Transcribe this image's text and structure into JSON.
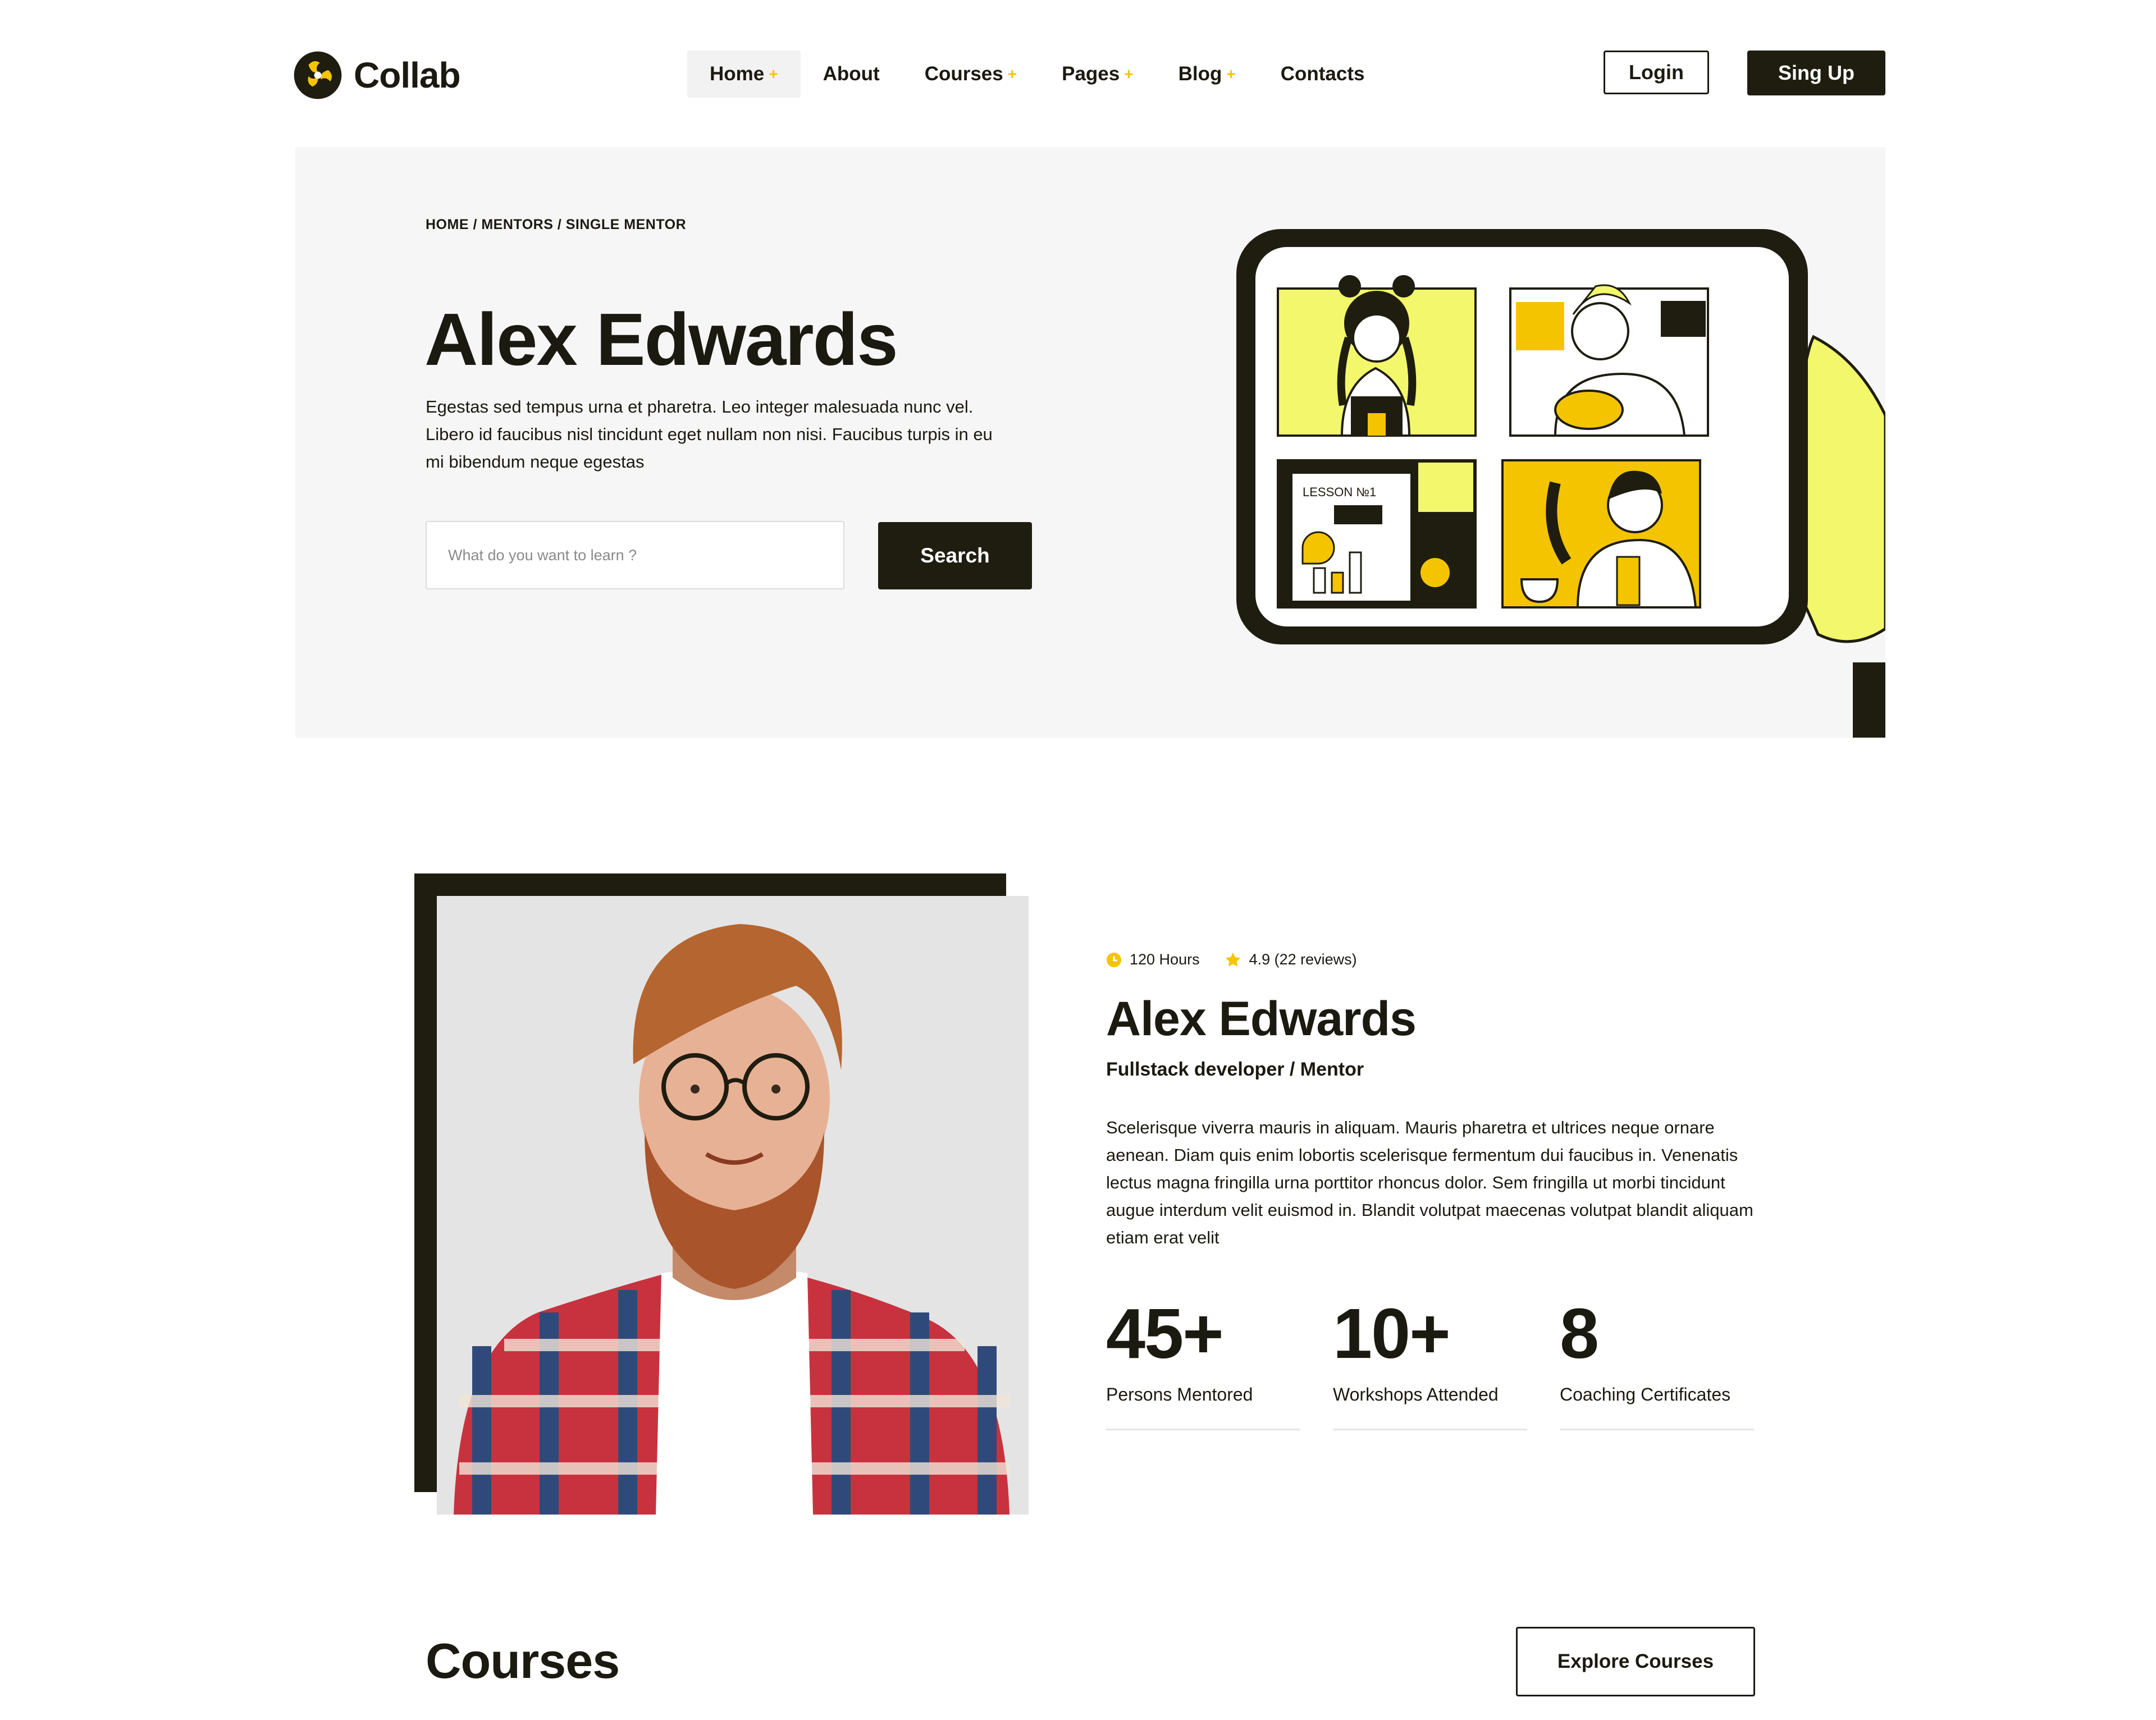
{
  "brand": {
    "name": "Collab",
    "accent": "#f5c400",
    "highlight": "#f3f76b",
    "dark": "#1e1d10"
  },
  "nav": {
    "items": [
      {
        "label": "Home",
        "plus": "+"
      },
      {
        "label": "About",
        "plus": ""
      },
      {
        "label": "Courses",
        "plus": "+"
      },
      {
        "label": "Pages",
        "plus": "+"
      },
      {
        "label": "Blog",
        "plus": "+"
      },
      {
        "label": "Contacts",
        "plus": ""
      }
    ],
    "active": "Home"
  },
  "auth": {
    "login_label": "Login",
    "signup_label": "Sing Up"
  },
  "hero": {
    "breadcrumb": {
      "home": "HOME",
      "sep": " / ",
      "mentors": "MENTORS",
      "current": "SINGLE MENTOR"
    },
    "title": "Alex Edwards",
    "description": "Egestas sed tempus urna et pharetra. Leo integer malesuada nunc vel. Libero id faucibus nisl tincidunt eget nullam non nisi. Faucibus turpis in eu mi bibendum neque egestas",
    "search": {
      "placeholder": "What do you want to learn ?",
      "value": "",
      "button_label": "Search"
    },
    "illustration": {
      "lesson_label": "LESSON №1",
      "icon": "video-call-tablet-illustration"
    }
  },
  "mentor": {
    "hours": "120 Hours",
    "rating": "4.9 (22 reviews)",
    "name": "Alex Edwards",
    "role": "Fullstack developer / Mentor",
    "bio": "Scelerisque viverra mauris in aliquam. Mauris pharetra et ultrices neque ornare aenean. Diam quis enim lobortis scelerisque fermentum dui faucibus in. Venenatis lectus magna fringilla urna porttitor rhoncus dolor. Sem fringilla ut morbi tincidunt augue interdum velit euismod in. Blandit volutpat maecenas volutpat blandit aliquam etiam erat velit",
    "stats": [
      {
        "value": "45+",
        "label": "Persons Mentored"
      },
      {
        "value": "10+",
        "label": "Workshops Attended"
      },
      {
        "value": "8",
        "label": "Coaching Certificates"
      }
    ]
  },
  "courses": {
    "title": "Courses",
    "explore_label": "Explore Courses"
  }
}
